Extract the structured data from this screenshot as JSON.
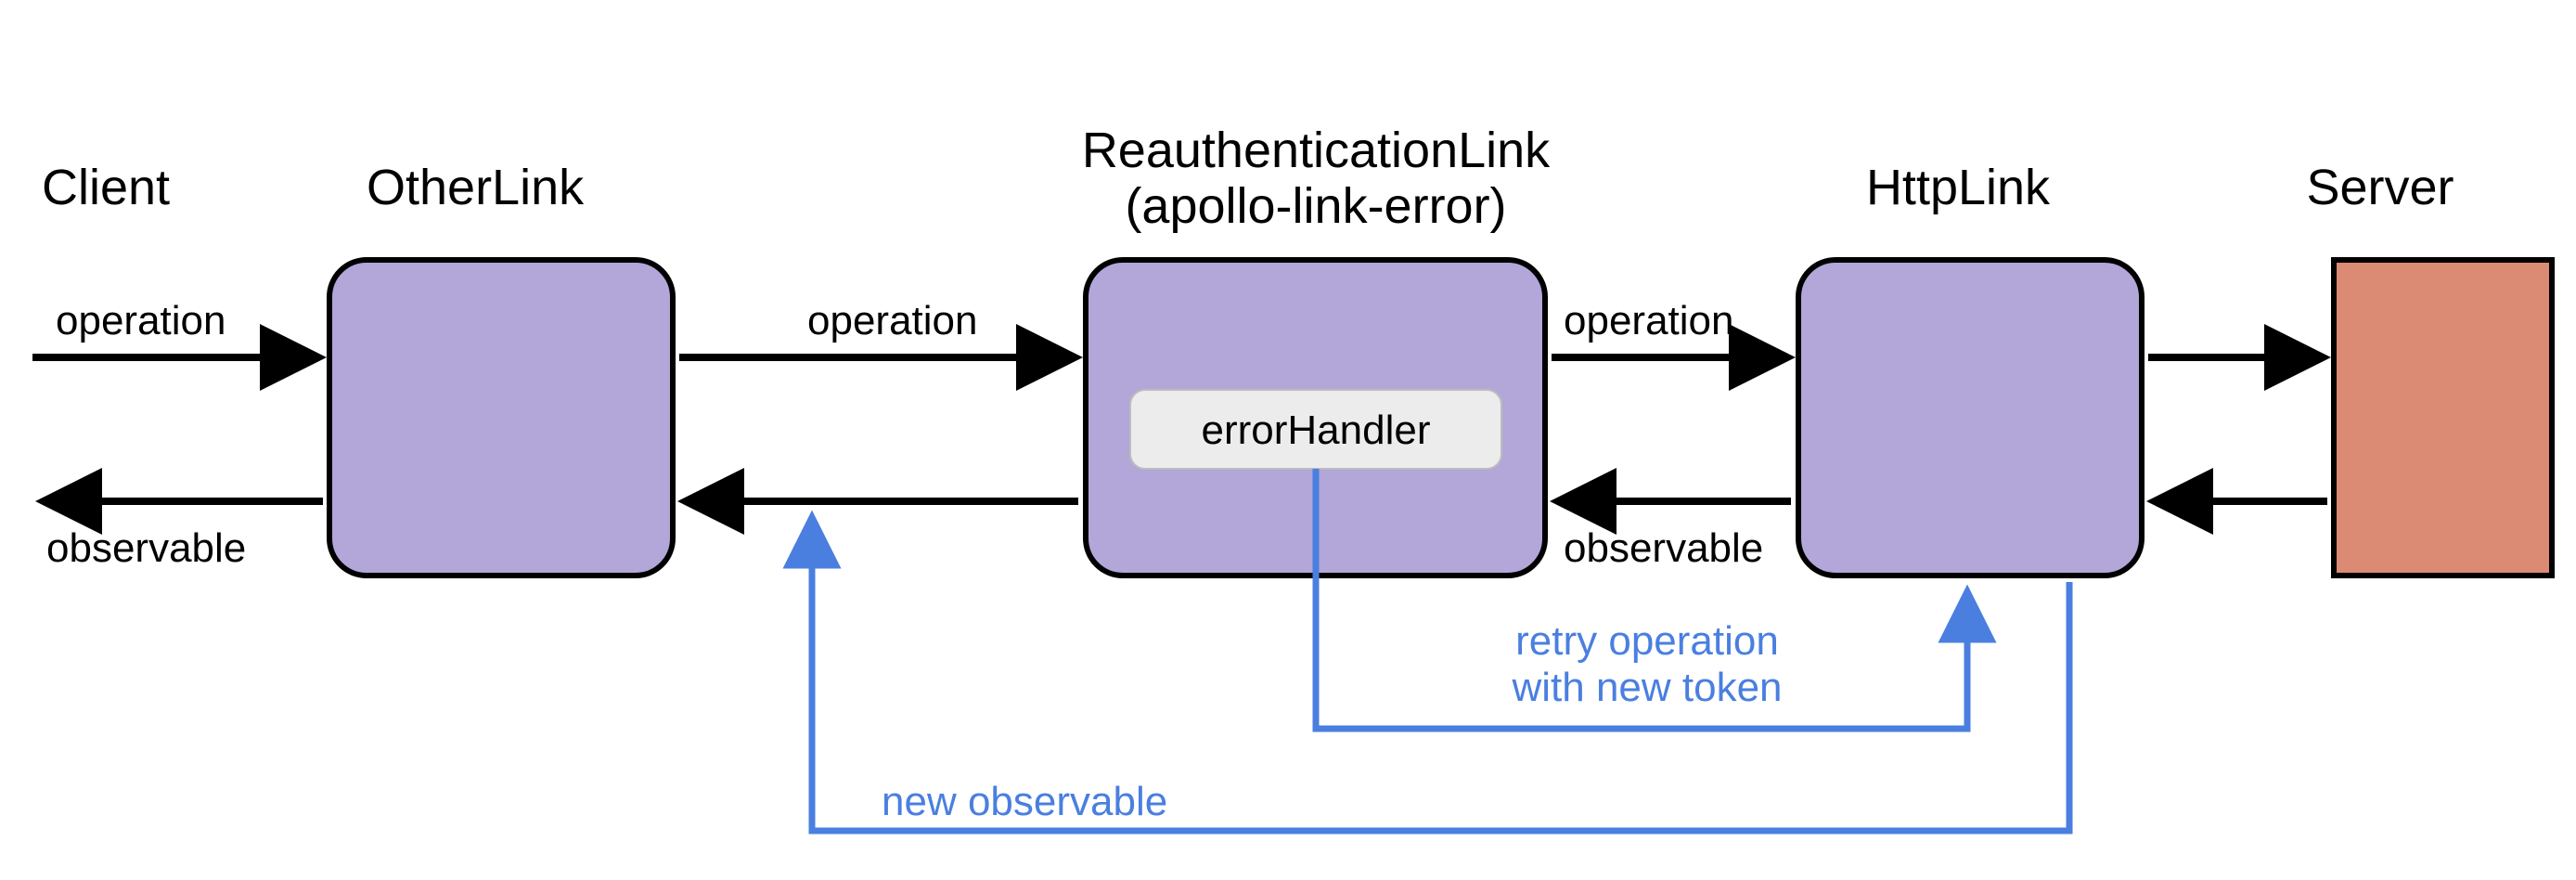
{
  "diagram": {
    "nodes": {
      "client": {
        "title": "Client"
      },
      "otherlink": {
        "title": "OtherLink"
      },
      "reauth": {
        "title_line1": "ReauthenticationLink",
        "title_line2": "(apollo-link-error)",
        "inner_label": "errorHandler"
      },
      "httplink": {
        "title": "HttpLink"
      },
      "server": {
        "title": "Server"
      }
    },
    "edges": {
      "op1": "operation",
      "obs1": "observable",
      "op2": "operation",
      "op3": "operation",
      "obs3": "observable",
      "retry_line1": "retry operation",
      "retry_line2": "with new token",
      "new_obs": "new observable"
    },
    "colors": {
      "node_fill": "#b3a6d8",
      "server_fill": "#db8a74",
      "inner_fill": "#ececec",
      "blue": "#4a7fe0",
      "black": "#000000"
    }
  }
}
